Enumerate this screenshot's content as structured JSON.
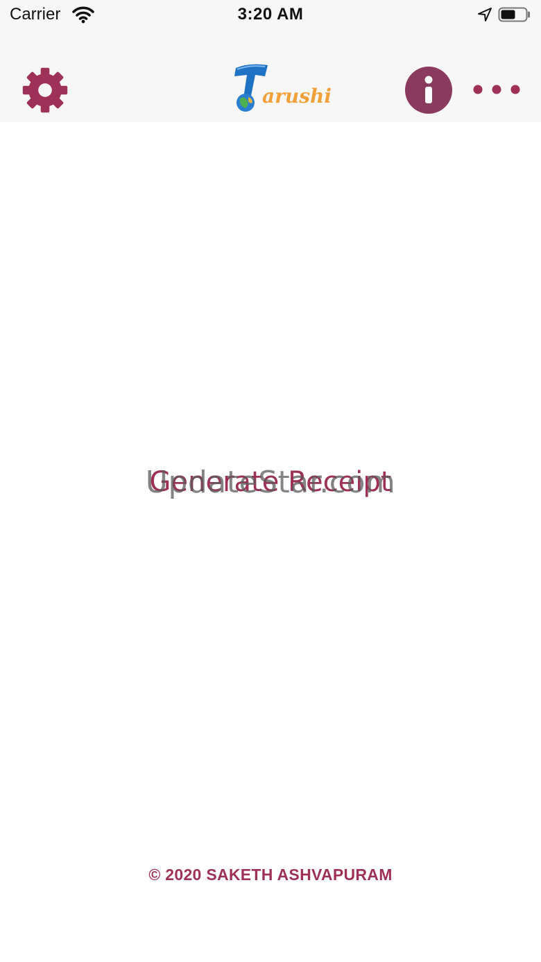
{
  "status_bar": {
    "carrier": "Carrier",
    "time": "3:20 AM",
    "icons": [
      "wifi-icon",
      "location-arrow-icon",
      "battery-icon"
    ]
  },
  "nav_bar": {
    "left_icon": "gear-icon",
    "logo_text": "arushi",
    "right_icons": [
      "info-icon",
      "more-dots-icon"
    ]
  },
  "main": {
    "action_label": "Generate Receipt",
    "watermark": "UpdateStar.com"
  },
  "footer": {
    "copyright": "© 2020 SAKETH ASHVAPURAM"
  },
  "colors": {
    "accent": "#9e3158",
    "info_fill": "#8a3a5c",
    "bar_background": "#f7f7f7"
  }
}
